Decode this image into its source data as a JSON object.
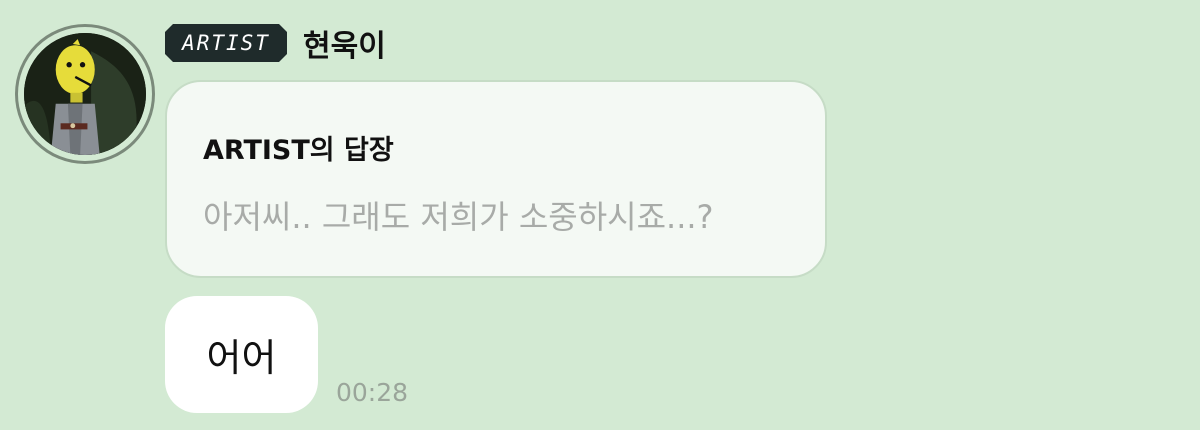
{
  "sender": {
    "avatar_icon": "lemon-character-avatar",
    "badge_text": "ARTIST",
    "name": "현욱이"
  },
  "reply": {
    "title": "ARTIST의 답장",
    "preview_text": "아저씨.. 그래도 저희가 소중하시죠...?"
  },
  "message": {
    "text": "어어",
    "time": "00:28"
  },
  "colors": {
    "background": "#d3ead3",
    "badge_bg": "#1f2b2b",
    "reply_card_bg": "#f4f9f4",
    "bubble_bg": "#ffffff"
  }
}
